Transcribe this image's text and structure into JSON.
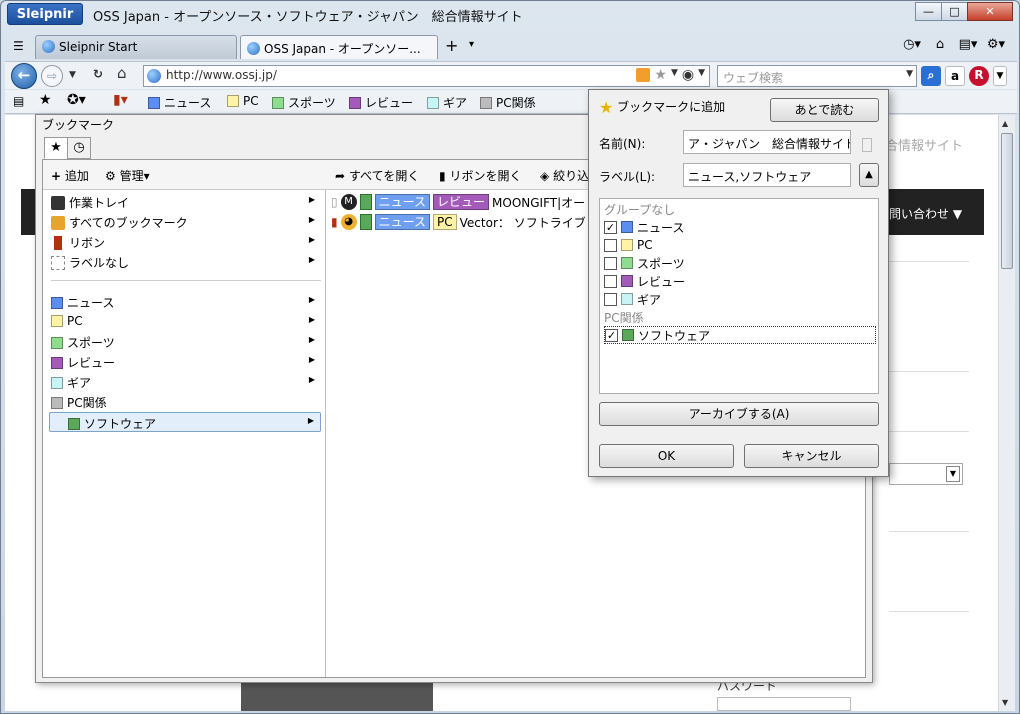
{
  "window": {
    "app_name": "Sleipnir",
    "title": "OSS Japan - オープンソース・ソフトウェア・ジャパン　総合情報サイト",
    "minimize": "▭",
    "maximize": "□",
    "close": "✕"
  },
  "tabs": [
    {
      "label": "Sleipnir Start",
      "active": false
    },
    {
      "label": "OSS Japan - オープンソー...",
      "active": true
    }
  ],
  "tab_tools": {
    "new_tab": "+",
    "menu": "▾"
  },
  "nav": {
    "url": "http://www.ossj.jp/",
    "search_placeholder": "ウェブ検索",
    "back": "←",
    "forward": "⇨",
    "reload": "C",
    "home": "⌂"
  },
  "search_engines": [
    {
      "icon": "search-icon",
      "glyph": "🔍",
      "color": "#2a6fd1"
    },
    {
      "icon": "amazon-icon",
      "glyph": "a",
      "color": "#ffffff"
    },
    {
      "icon": "rakuten-icon",
      "glyph": "R",
      "color": "#c8102e"
    }
  ],
  "bookmark_bar": {
    "items": [
      {
        "label": "ニュース",
        "color": "#5b8ef0"
      },
      {
        "label": "PC",
        "color": "#fff3a6"
      },
      {
        "label": "スポーツ",
        "color": "#8fdc8f"
      },
      {
        "label": "レビュー",
        "color": "#a35ab8"
      },
      {
        "label": "ギア",
        "color": "#c8f4f6"
      },
      {
        "label": "PC関係",
        "color": "#bbbbbb"
      }
    ]
  },
  "page": {
    "ghost_title": "合情報サイト",
    "contact": "問い合わせ ▼",
    "password_label": "パスワード"
  },
  "bookmark_panel": {
    "title": "ブックマーク",
    "toolbar": {
      "add": "追加",
      "manage": "管理▾",
      "open_all": "すべてを開く",
      "open_ribbon": "リボンを開く",
      "filter": "絞り込"
    },
    "left_items": [
      {
        "label": "作業トレイ",
        "icon": "tray-icon"
      },
      {
        "label": "すべてのブックマーク",
        "icon": "all-bookmarks-icon"
      },
      {
        "label": "リボン",
        "icon": "ribbon-icon"
      },
      {
        "label": "ラベルなし",
        "icon": "no-label-icon"
      }
    ],
    "label_items": [
      {
        "label": "ニュース",
        "color": "#5b8ef0",
        "has_arrow": true
      },
      {
        "label": "PC",
        "color": "#fff3a6",
        "has_arrow": true
      },
      {
        "label": "スポーツ",
        "color": "#8fdc8f",
        "has_arrow": true
      },
      {
        "label": "レビュー",
        "color": "#a35ab8",
        "has_arrow": true
      },
      {
        "label": "ギア",
        "color": "#c8f4f6",
        "has_arrow": true
      },
      {
        "label": "PC関係",
        "color": "#bbbbbb",
        "has_arrow": false
      }
    ],
    "selected_item": {
      "label": "ソフトウェア",
      "color": "#5aa85a"
    },
    "bookmarks": [
      {
        "labels": [
          {
            "text": "ニュース",
            "kind": "news"
          },
          {
            "text": "レビュー",
            "kind": "review"
          }
        ],
        "title": "MOONGIFT|オー"
      },
      {
        "labels": [
          {
            "text": "ニュース",
            "kind": "news"
          },
          {
            "text": "PC",
            "kind": "pc"
          }
        ],
        "title": "Vector： ソフトライブ"
      }
    ]
  },
  "dialog": {
    "title": "ブックマークに追加",
    "read_later": "あとで読む",
    "name_label": "名前(N):",
    "name_value": "ア・ジャパン　総合情報サイト",
    "label_label": "ラベル(L):",
    "label_value": "ニュース,ソフトウェア",
    "group_none": "グループなし",
    "checks": [
      {
        "label": "ニュース",
        "color": "#5b8ef0",
        "checked": "✓"
      },
      {
        "label": "PC",
        "color": "#fff3a6",
        "checked": ""
      },
      {
        "label": "スポーツ",
        "color": "#8fdc8f",
        "checked": ""
      },
      {
        "label": "レビュー",
        "color": "#a35ab8",
        "checked": ""
      },
      {
        "label": "ギア",
        "color": "#c8f4f6",
        "checked": ""
      }
    ],
    "group_pc": "PC関係",
    "pc_checks": [
      {
        "label": "ソフトウェア",
        "color": "#5aa85a",
        "checked": "✓"
      }
    ],
    "archive": "アーカイブする(A)",
    "ok": "OK",
    "cancel": "キャンセル"
  }
}
